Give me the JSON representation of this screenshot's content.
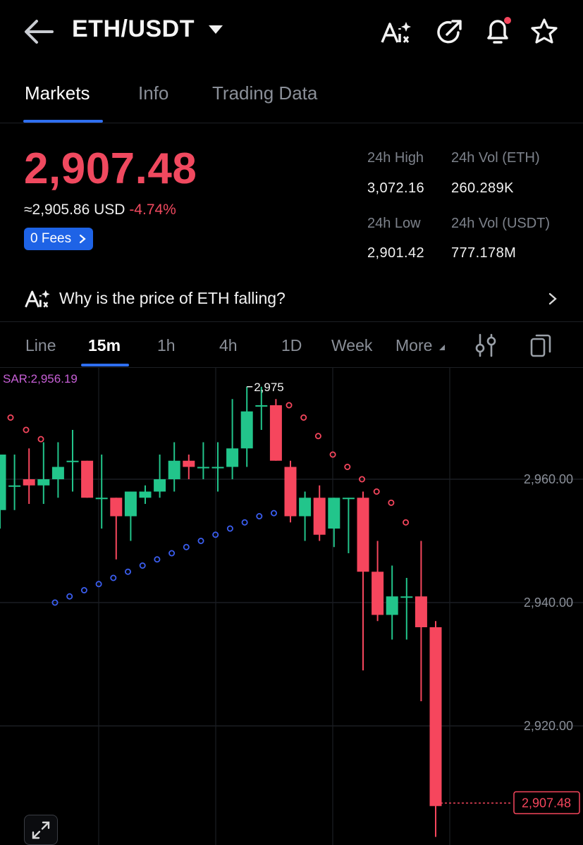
{
  "header": {
    "title": "ETH/USDT"
  },
  "tabs": [
    "Markets",
    "Info",
    "Trading Data"
  ],
  "ticker": {
    "price": "2,907.48",
    "approx": "≈2,905.86",
    "currency": "USD",
    "change": "-4.74%",
    "fees_label": "0 Fees",
    "high_label": "24h High",
    "high_value": "3,072.16",
    "vol_eth_label": "24h Vol (ETH)",
    "vol_eth_value": "260.289K",
    "low_label": "24h Low",
    "low_value": "2,901.42",
    "vol_usdt_label": "24h Vol  (USDT)",
    "vol_usdt_value": "777.178M"
  },
  "why_text": "Why is the price of ETH falling?",
  "timeframes": [
    "Line",
    "15m",
    "1h",
    "4h",
    "1D",
    "Week",
    "More"
  ],
  "colors": {
    "up": "#22c58b",
    "down": "#f6465d",
    "accent": "#2f6ff0",
    "sar_upper": "#f6465d",
    "sar_lower": "#3b5ef0"
  },
  "icons": [
    "back-arrow-icon",
    "ai-icon",
    "share-icon",
    "bell-icon",
    "star-icon",
    "indicator-settings-icon",
    "copy-icon",
    "expand-icon"
  ],
  "chart_data": {
    "type": "candlestick",
    "indicator": "SAR:2,956.19",
    "y_ticks": [
      "2,960.00",
      "2,940.00",
      "2,920.00"
    ],
    "y_tick_values": [
      2960,
      2940,
      2920
    ],
    "max_label": "2,975",
    "last_price_label": "2,907.48",
    "last_price": 2907.48,
    "candles": [
      {
        "o": 2955,
        "h": 2961,
        "l": 2952,
        "c": 2964
      },
      {
        "o": 2959,
        "h": 2964,
        "l": 2955,
        "c": 2959
      },
      {
        "o": 2960,
        "h": 2965,
        "l": 2956,
        "c": 2959
      },
      {
        "o": 2959,
        "h": 2966,
        "l": 2956,
        "c": 2960
      },
      {
        "o": 2960,
        "h": 2966,
        "l": 2957,
        "c": 2962
      },
      {
        "o": 2963,
        "h": 2968,
        "l": 2958,
        "c": 2963
      },
      {
        "o": 2963,
        "h": 2963,
        "l": 2957,
        "c": 2957
      },
      {
        "o": 2957,
        "h": 2964,
        "l": 2952,
        "c": 2957
      },
      {
        "o": 2957,
        "h": 2956,
        "l": 2947,
        "c": 2954
      },
      {
        "o": 2954,
        "h": 2958,
        "l": 2950,
        "c": 2958
      },
      {
        "o": 2957,
        "h": 2959,
        "l": 2956,
        "c": 2958
      },
      {
        "o": 2958,
        "h": 2964,
        "l": 2957,
        "c": 2960
      },
      {
        "o": 2960,
        "h": 2966,
        "l": 2958,
        "c": 2963
      },
      {
        "o": 2963,
        "h": 2964,
        "l": 2960,
        "c": 2962
      },
      {
        "o": 2962,
        "h": 2966,
        "l": 2960,
        "c": 2962
      },
      {
        "o": 2962,
        "h": 2966,
        "l": 2958,
        "c": 2962
      },
      {
        "o": 2962,
        "h": 2973,
        "l": 2960,
        "c": 2965
      },
      {
        "o": 2965,
        "h": 2975,
        "l": 2962,
        "c": 2971
      },
      {
        "o": 2972,
        "h": 2975,
        "l": 2968,
        "c": 2972
      },
      {
        "o": 2972,
        "h": 2973,
        "l": 2964,
        "c": 2963
      },
      {
        "o": 2962,
        "h": 2963,
        "l": 2953,
        "c": 2954
      },
      {
        "o": 2954,
        "h": 2958,
        "l": 2950,
        "c": 2957
      },
      {
        "o": 2957,
        "h": 2959,
        "l": 2950,
        "c": 2951
      },
      {
        "o": 2952,
        "h": 2957,
        "l": 2949,
        "c": 2957
      },
      {
        "o": 2957,
        "h": 2957,
        "l": 2948,
        "c": 2957
      },
      {
        "o": 2957,
        "h": 2958,
        "l": 2929,
        "c": 2945
      },
      {
        "o": 2945,
        "h": 2950,
        "l": 2937,
        "c": 2938
      },
      {
        "o": 2938,
        "h": 2946,
        "l": 2934,
        "c": 2941
      },
      {
        "o": 2941,
        "h": 2944,
        "l": 2934,
        "c": 2941
      },
      {
        "o": 2941,
        "h": 2950,
        "l": 2924,
        "c": 2936
      },
      {
        "o": 2936,
        "h": 2937,
        "l": 2902,
        "c": 2907
      }
    ],
    "sar_upper": [
      2972,
      2970,
      2967,
      2964,
      2962,
      2960,
      2958,
      2956.19,
      2953
    ],
    "sar_lower": [
      2940,
      2941,
      2942,
      2943,
      2944,
      2945,
      2946,
      2947,
      2948,
      2949,
      2950,
      2951,
      2952,
      2953,
      2954,
      2954.5
    ]
  }
}
